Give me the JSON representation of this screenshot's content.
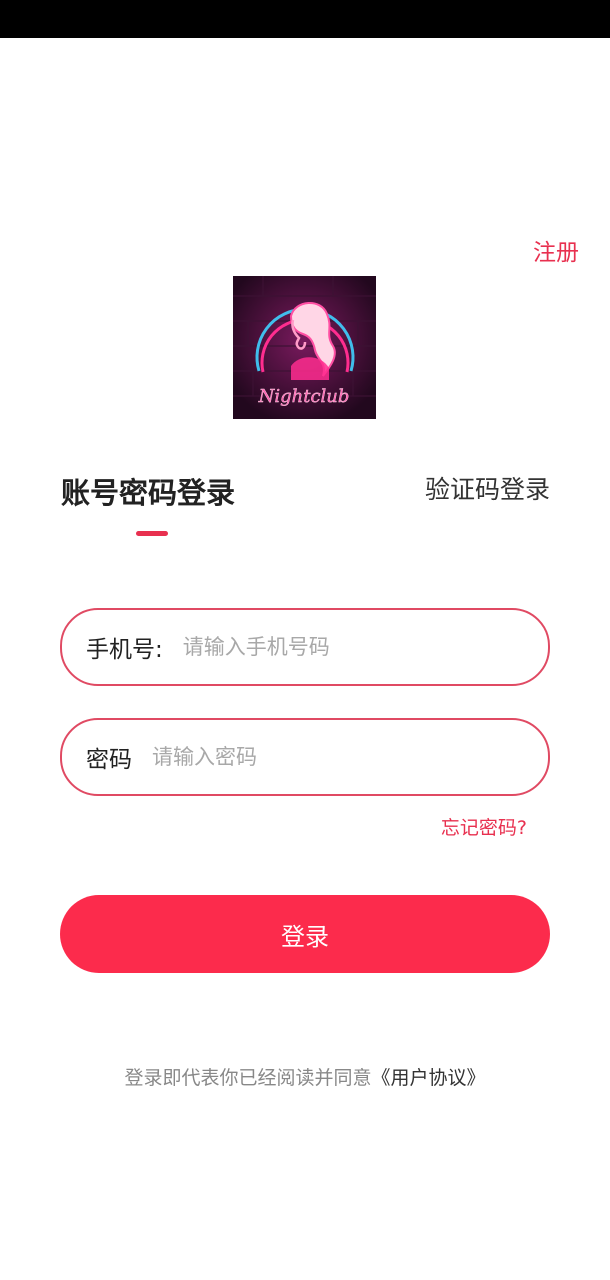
{
  "header": {
    "register_label": "注册"
  },
  "logo": {
    "text": "Nightclub",
    "icon": "neon-woman-logo"
  },
  "tabs": {
    "password_login_label": "账号密码登录",
    "code_login_label": "验证码登录",
    "active": "password_login"
  },
  "form": {
    "phone_label": "手机号:",
    "phone_placeholder": "请输入手机号码",
    "phone_value": "",
    "password_label": "密码",
    "password_placeholder": "请输入密码",
    "password_value": "",
    "forgot_label": "忘记密码?"
  },
  "login_button_label": "登录",
  "agreement": {
    "prefix": "登录即代表你已经阅读并同意",
    "link_label": "《用户协议》"
  },
  "colors": {
    "accent": "#e8304f",
    "button": "#fc2b4c",
    "status_bar": "#000000"
  }
}
